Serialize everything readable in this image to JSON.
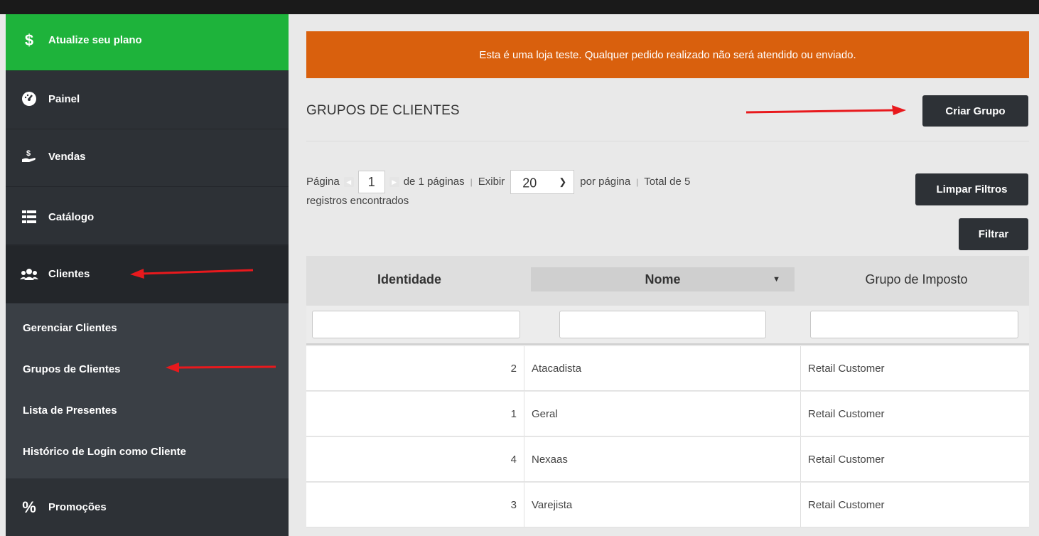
{
  "sidebar": {
    "upgrade": {
      "label": "Atualize seu plano",
      "icon": "dollar-icon"
    },
    "items": [
      {
        "label": "Painel",
        "icon": "dashboard-icon"
      },
      {
        "label": "Vendas",
        "icon": "sales-icon"
      },
      {
        "label": "Catálogo",
        "icon": "catalog-icon"
      },
      {
        "label": "Clientes",
        "icon": "users-icon"
      }
    ],
    "submenu": [
      "Gerenciar Clientes",
      "Grupos de Clientes",
      "Lista de Presentes",
      "Histórico de Login como Cliente"
    ],
    "promotions": {
      "label": "Promoções",
      "icon": "percent-icon"
    }
  },
  "notice": "Esta é uma loja teste. Qualquer pedido realizado não será atendido ou enviado.",
  "page_title": "GRUPOS DE CLIENTES",
  "buttons": {
    "create": "Criar Grupo",
    "clear": "Limpar Filtros",
    "filter": "Filtrar"
  },
  "pager": {
    "page_label": "Página",
    "page_value": "1",
    "of_pages": "de 1 páginas",
    "show_label": "Exibir",
    "per_page_value": "20",
    "per_page_label": "por página",
    "total": "Total de 5",
    "total_suffix": "registros encontrados"
  },
  "table": {
    "headers": {
      "id": "Identidade",
      "nome": "Nome",
      "tax": "Grupo de Imposto"
    },
    "rows": [
      {
        "id": "2",
        "nome": "Atacadista",
        "tax": "Retail Customer"
      },
      {
        "id": "1",
        "nome": "Geral",
        "tax": "Retail Customer"
      },
      {
        "id": "4",
        "nome": "Nexaas",
        "tax": "Retail Customer"
      },
      {
        "id": "3",
        "nome": "Varejista",
        "tax": "Retail Customer"
      }
    ]
  },
  "colors": {
    "upgrade_green": "#1eb33b",
    "notice_orange": "#d9600d",
    "sidebar_dark": "#2d3136",
    "annotation_red": "#e8191d"
  }
}
